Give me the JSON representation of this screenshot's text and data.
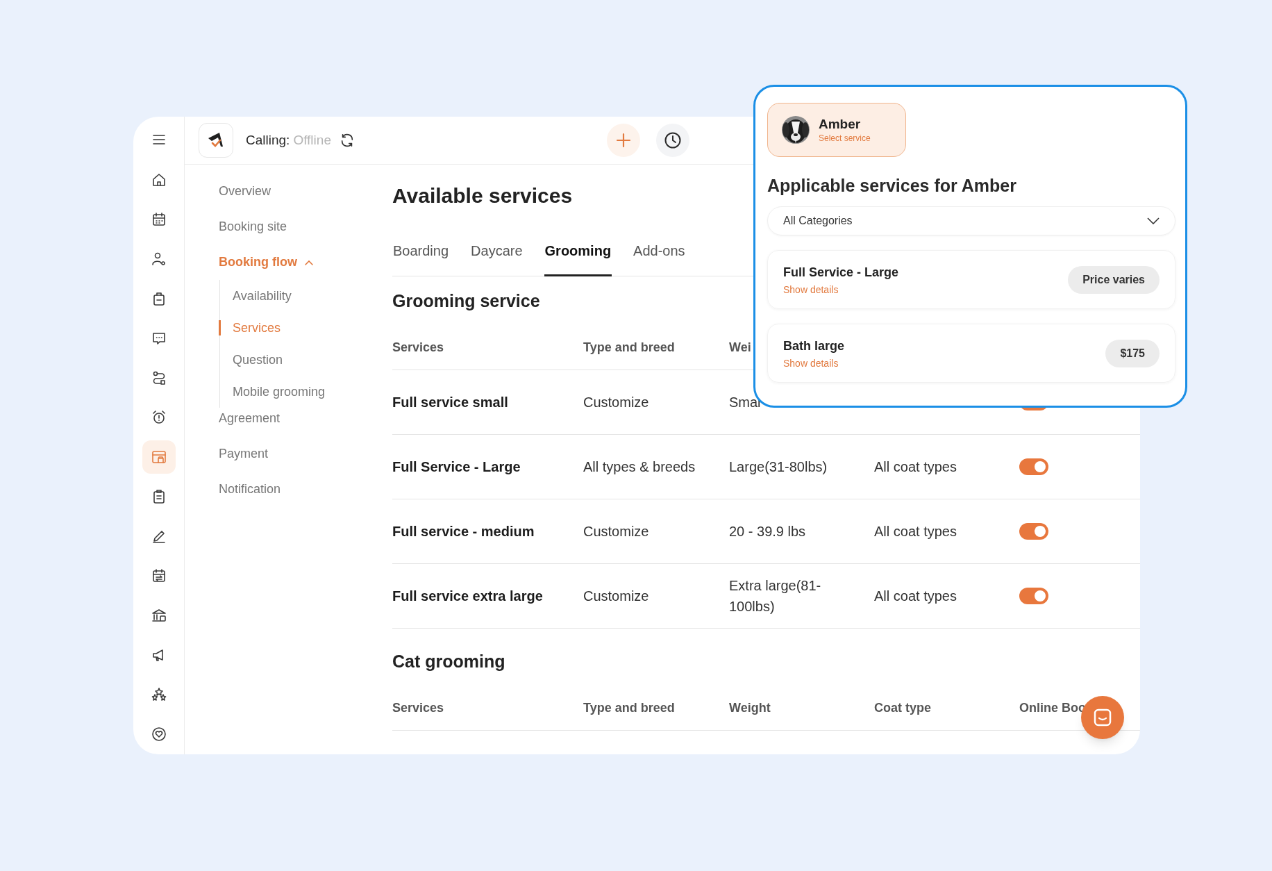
{
  "rail": [
    {
      "selected": false
    },
    {
      "selected": false
    },
    {
      "selected": false
    },
    {
      "selected": false
    },
    {
      "selected": false
    },
    {
      "selected": false
    },
    {
      "selected": false
    },
    {
      "selected": true
    },
    {
      "selected": false
    },
    {
      "selected": false
    },
    {
      "selected": false
    },
    {
      "selected": false
    },
    {
      "selected": false
    },
    {
      "selected": false
    },
    {
      "selected": false
    }
  ],
  "header": {
    "calling_label": "Calling:",
    "calling_status": "Offline"
  },
  "submenu": [
    {
      "label": "Overview",
      "selected": false
    },
    {
      "label": "Booking site",
      "selected": false
    },
    {
      "label": "Booking flow",
      "selected": true,
      "expanded": true,
      "children": [
        {
          "label": "Availability",
          "selected": false
        },
        {
          "label": "Services",
          "selected": true
        },
        {
          "label": "Question",
          "selected": false
        },
        {
          "label": "Mobile grooming",
          "selected": false
        }
      ]
    },
    {
      "label": "Agreement",
      "selected": false
    },
    {
      "label": "Payment",
      "selected": false
    },
    {
      "label": "Notification",
      "selected": false
    }
  ],
  "title": "Available services",
  "tabs": [
    {
      "label": "Boarding",
      "selected": false
    },
    {
      "label": "Daycare",
      "selected": false
    },
    {
      "label": "Grooming",
      "selected": true
    },
    {
      "label": "Add-ons",
      "selected": false
    }
  ],
  "sections": [
    {
      "title": "Grooming service",
      "columns": [
        "Services",
        "Type and breed",
        "Wei"
      ],
      "rows": [
        {
          "cells": [
            "Full service small",
            "Customize",
            "Smal"
          ],
          "online": true
        },
        {
          "cells": [
            "Full Service - Large",
            "All types & breeds",
            "Large(31-80lbs)",
            "All coat types"
          ],
          "online": true
        },
        {
          "cells": [
            "Full service - medium",
            "Customize",
            "20 - 39.9 lbs",
            "All coat types"
          ],
          "online": true
        },
        {
          "cells": [
            "Full service extra large",
            "Customize",
            "Extra large(81-100lbs)",
            "All coat types"
          ],
          "online": true
        }
      ]
    },
    {
      "title": "Cat grooming",
      "columns": [
        "Services",
        "Type and breed",
        "Weight",
        "Coat type",
        "Online Boo"
      ]
    }
  ],
  "popup": {
    "pet": {
      "name": "Amber",
      "action": "Select service"
    },
    "title": "Applicable services for Amber",
    "category": "All Categories",
    "services": [
      {
        "name": "Full Service - Large",
        "link": "Show details",
        "price": "Price varies"
      },
      {
        "name": "Bath large",
        "link": "Show details",
        "price": "$175"
      }
    ]
  }
}
